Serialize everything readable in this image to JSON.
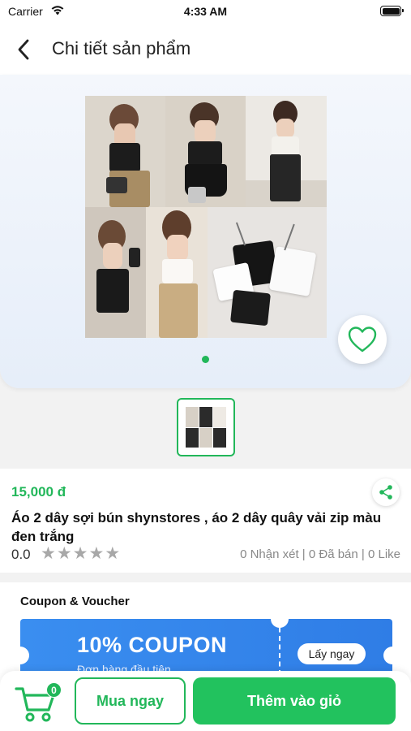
{
  "status_bar": {
    "carrier": "Carrier",
    "time": "4:33 AM"
  },
  "header": {
    "title": "Chi tiết sản phẩm"
  },
  "gallery": {
    "image_count": 1,
    "active_index": 0
  },
  "product": {
    "price": "15,000 đ",
    "name": "Áo 2 dây sợi bún shynstores , áo 2 dây quây vải zip màu đen trắng",
    "rating": "0.0",
    "rating_stars": 0,
    "stats": "0 Nhận xét | 0 Đã bán | 0 Like"
  },
  "coupon": {
    "section_title": "Coupon & Voucher",
    "amount": "10% COUPON",
    "subtitle": "Đơn hàng đầu tiên",
    "claim_label": "Lấy ngay"
  },
  "bottom_bar": {
    "cart_count": "0",
    "buy_now_label": "Mua ngay",
    "add_to_cart_label": "Thêm vào giỏ"
  },
  "colors": {
    "accent": "#22b75a",
    "coupon_blue": "#3a8ef0",
    "star_empty": "#a8a8a8"
  },
  "icons": [
    "wifi-icon",
    "battery-icon",
    "back-arrow-icon",
    "heart-icon",
    "share-icon",
    "star-icon",
    "cart-icon"
  ]
}
